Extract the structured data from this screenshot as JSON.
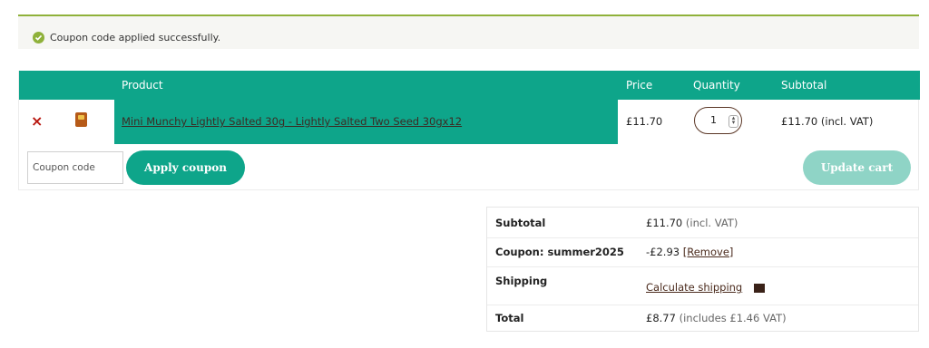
{
  "notice": {
    "message": "Coupon code applied successfully."
  },
  "cart": {
    "headers": {
      "product": "Product",
      "price": "Price",
      "quantity": "Quantity",
      "subtotal": "Subtotal"
    },
    "item": {
      "remove_symbol": "×",
      "name": "Mini Munchy Lightly Salted 30g - Lightly Salted Two Seed 30gx12",
      "price": "£11.70",
      "quantity": "1",
      "subtotal": "£11.70 (incl. VAT)"
    },
    "coupon_placeholder": "Coupon code",
    "apply_label": "Apply coupon",
    "update_label": "Update cart"
  },
  "totals": {
    "subtotal_label": "Subtotal",
    "subtotal_value": "£11.70",
    "subtotal_note": "(incl. VAT)",
    "coupon_label": "Coupon: summer2025",
    "coupon_value": "-£2.93",
    "coupon_remove": "[Remove]",
    "shipping_label": "Shipping",
    "shipping_link": "Calculate shipping",
    "total_label": "Total",
    "total_value": "£8.77",
    "total_note": "(includes £1.46 VAT)"
  },
  "colors": {
    "accent": "#0ea58a",
    "accent_disabled": "#8fd4c6",
    "notice_border": "#8fb13a",
    "remove": "#b8160f"
  }
}
